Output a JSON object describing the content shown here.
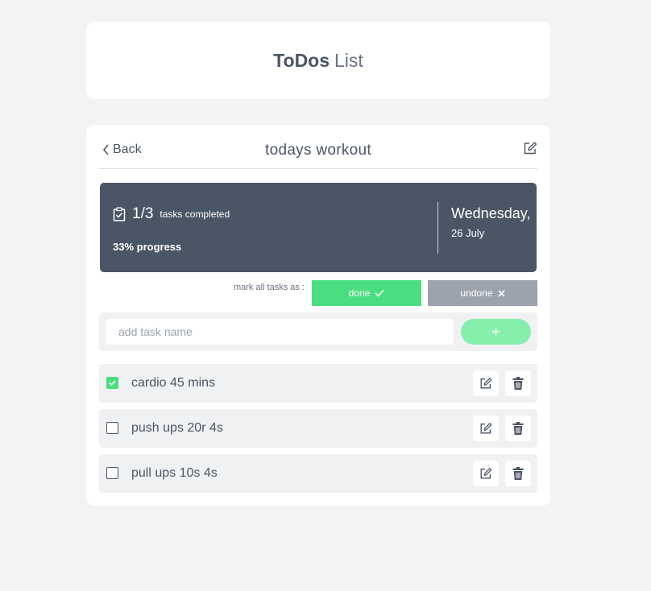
{
  "app_title": {
    "bold": "ToDos",
    "light": "List"
  },
  "header": {
    "back_label": "Back",
    "list_title": "todays workout"
  },
  "summary": {
    "completed_count": "1/3",
    "completed_label": "tasks completed",
    "progress_text": "33% progress",
    "progress_value": 0.33,
    "weekday": "Wednesday,",
    "date": "26 July"
  },
  "mark_all": {
    "label": "mark all tasks as :",
    "done_label": "done",
    "undone_label": "undone"
  },
  "add_task": {
    "placeholder": "add task name",
    "add_label": "+"
  },
  "tasks": [
    {
      "name": "cardio 45 mins",
      "done": true
    },
    {
      "name": "push ups 20r 4s",
      "done": false
    },
    {
      "name": "pull ups 10s 4s",
      "done": false
    }
  ],
  "colors": {
    "accent_green": "#4ade80",
    "summary_bg": "#4a5565",
    "undone_gray": "#9ca3af",
    "page_bg": "#f2f3f5"
  },
  "icons": {
    "back": "chevron-left-icon",
    "edit": "pencil-square-icon",
    "delete": "trash-icon",
    "clipboard": "clipboard-check-icon",
    "check": "check-icon",
    "close": "x-icon"
  }
}
